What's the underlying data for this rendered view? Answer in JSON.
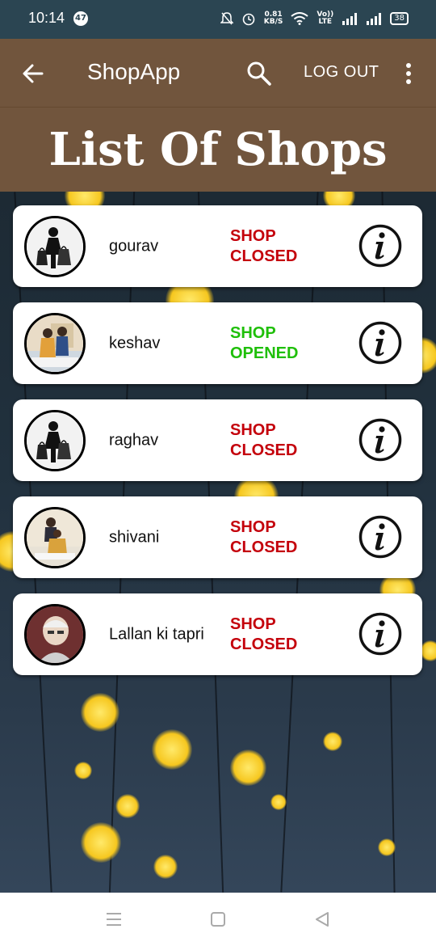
{
  "status_bar": {
    "time": "10:14",
    "notification_count": "47",
    "speed_value": "0.81",
    "speed_unit": "KB/S",
    "network_label_top": "Vo))",
    "network_label_bottom": "LTE",
    "battery": "38"
  },
  "app_bar": {
    "title": "ShopApp",
    "logout_label": "LOG OUT",
    "back_icon": "arrow-left-icon",
    "search_icon": "search-icon",
    "more_icon": "more-vertical-icon"
  },
  "heading": "List Of Shops",
  "colors": {
    "appbar": "#71553d",
    "status_bar": "#2b4552",
    "closed": "#c4000b",
    "opened": "#1fbf09"
  },
  "shops": [
    {
      "name": "gourav",
      "status_line1": "SHOP",
      "status_line2": "CLOSED",
      "state": "closed",
      "avatar": "shopping-bag-person-icon"
    },
    {
      "name": "keshav",
      "status_line1": "SHOP",
      "status_line2": "OPENED",
      "state": "opened",
      "avatar": "people-photo"
    },
    {
      "name": "raghav",
      "status_line1": "SHOP",
      "status_line2": "CLOSED",
      "state": "closed",
      "avatar": "shopping-bag-person-icon"
    },
    {
      "name": "shivani",
      "status_line1": "SHOP",
      "status_line2": "CLOSED",
      "state": "closed",
      "avatar": "people-photo"
    },
    {
      "name": "Lallan ki tapri",
      "status_line1": "SHOP",
      "status_line2": "CLOSED",
      "state": "closed",
      "avatar": "person-photo"
    }
  ],
  "nav_bar": {
    "menu_icon": "menu-icon",
    "home_icon": "square-home-icon",
    "back_icon": "triangle-back-icon"
  }
}
